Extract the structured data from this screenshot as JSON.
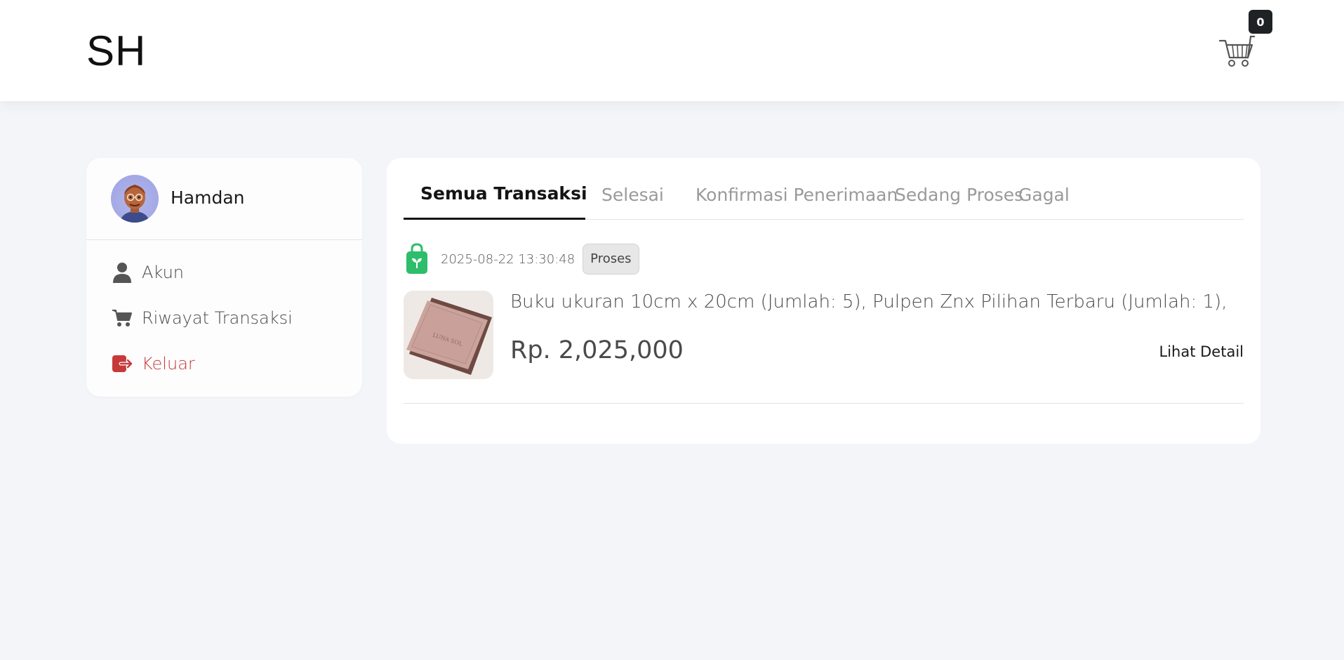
{
  "header": {
    "brand": "SH",
    "cart_count": "0",
    "cart_icon": "shopping-cart-icon"
  },
  "sidebar": {
    "user_name": "Hamdan",
    "items": [
      {
        "label": "Akun",
        "icon": "user-icon"
      },
      {
        "label": "Riwayat Transaksi",
        "icon": "cart-icon"
      },
      {
        "label": "Keluar",
        "icon": "logout-icon"
      }
    ],
    "logout_color": "#c73a3a"
  },
  "tabs": [
    {
      "label": "Semua Transaksi",
      "active": true
    },
    {
      "label": "Selesai",
      "active": false
    },
    {
      "label": "Konfirmasi Penerimaan",
      "active": false
    },
    {
      "label": "Sedang Proses",
      "active": false
    },
    {
      "label": "Gagal",
      "active": false
    }
  ],
  "transactions": [
    {
      "date": "2025-08-22 13:30:48",
      "status": "Proses",
      "store_icon": "shopping-bag-icon",
      "items_text": "Buku ukuran 10cm x 20cm (Jumlah: 5), Pulpen Znx Pilihan Terbaru (Jumlah: 1),",
      "price": "Rp. 2,025,000",
      "detail_label": "Lihat Detail",
      "thumb_text": "LUNA SOL"
    }
  ],
  "colors": {
    "accent_green": "#2ebd6b",
    "background": "#f4f5f9",
    "active_tab": "#141414"
  }
}
